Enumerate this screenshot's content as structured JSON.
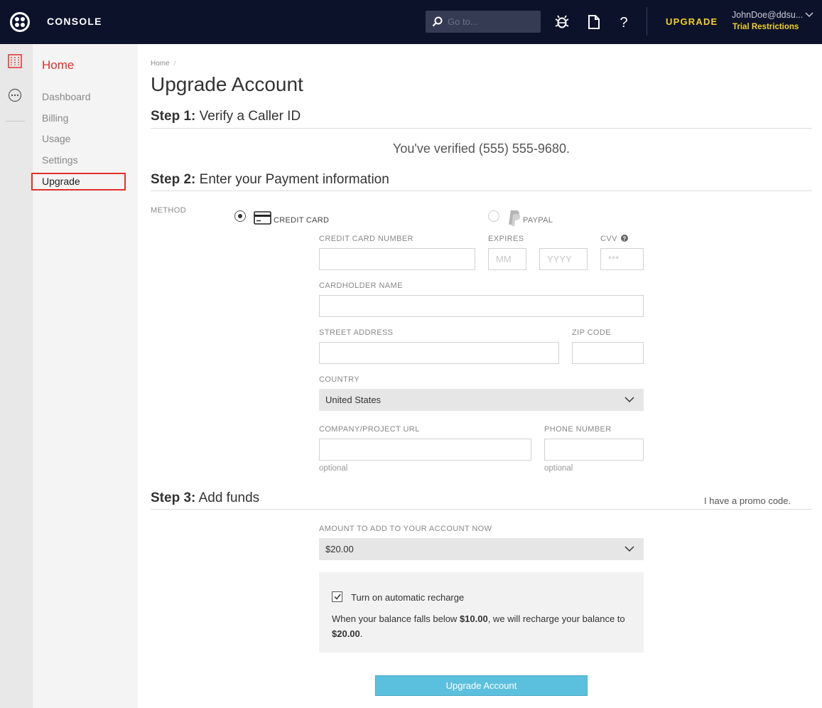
{
  "topbar": {
    "console_label": "CONSOLE",
    "search_placeholder": "Go to...",
    "icons": [
      "debugger-icon",
      "docs-icon",
      "help-icon"
    ],
    "upgrade_label": "UPGRADE",
    "user_name": "JohnDoe@ddsu...",
    "trial_label": "Trial Restrictions",
    "colors": {
      "bg": "#0d122b",
      "accent": "#f2d124"
    }
  },
  "rail": {
    "icons": [
      "dashboard-icon",
      "more-icon"
    ]
  },
  "subnav": {
    "home_label": "Home",
    "items": [
      {
        "label": "Dashboard"
      },
      {
        "label": "Billing"
      },
      {
        "label": "Usage"
      },
      {
        "label": "Settings"
      },
      {
        "label": "Upgrade",
        "active": true
      }
    ]
  },
  "breadcrumb": {
    "home": "Home",
    "separator": "/"
  },
  "page_title": "Upgrade Account",
  "step1": {
    "prefix": "Step 1:",
    "title": "Verify a Caller ID",
    "verified_text": "You've verified (555) 555-9680."
  },
  "step2": {
    "prefix": "Step 2:",
    "title": "Enter your Payment information",
    "method_label": "METHOD",
    "methods": [
      {
        "label": "CREDIT CARD",
        "selected": true
      },
      {
        "label": "PAYPAL",
        "selected": false
      }
    ],
    "fields": {
      "card_number": {
        "label": "CREDIT CARD NUMBER",
        "value": ""
      },
      "expires": {
        "label": "EXPIRES",
        "mm_placeholder": "MM",
        "yyyy_placeholder": "YYYY"
      },
      "cvv": {
        "label": "CVV",
        "placeholder": "***"
      },
      "cardholder": {
        "label": "CARDHOLDER NAME",
        "value": ""
      },
      "street": {
        "label": "STREET ADDRESS",
        "value": ""
      },
      "zip": {
        "label": "ZIP CODE",
        "value": ""
      },
      "country": {
        "label": "COUNTRY",
        "value": "United States"
      },
      "url": {
        "label": "COMPANY/PROJECT URL",
        "hint": "optional"
      },
      "phone": {
        "label": "PHONE NUMBER",
        "hint": "optional"
      }
    }
  },
  "step3": {
    "prefix": "Step 3:",
    "title": "Add funds",
    "promo_link": "I have a promo code.",
    "amount_label": "AMOUNT TO ADD TO YOUR ACCOUNT NOW",
    "amount_value": "$20.00",
    "recharge": {
      "checked": true,
      "label": "Turn on automatic recharge",
      "desc_1": "When your balance falls below ",
      "threshold": "$10.00",
      "desc_2": ", we will recharge your balance to ",
      "recharge_amount": "$20.00",
      "desc_3": "."
    },
    "submit_label": "Upgrade Account"
  }
}
